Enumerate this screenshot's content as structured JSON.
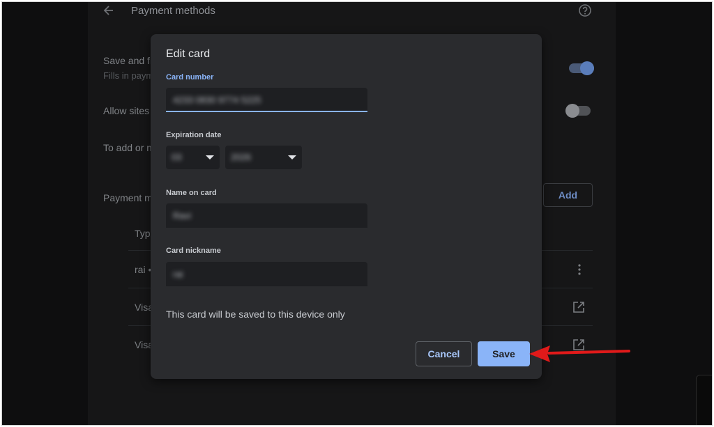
{
  "settings_page": {
    "title": "Payment methods",
    "autofill_label": "Save and fi",
    "autofill_sub": "Fills in paym",
    "allow_sites_label": "Allow sites",
    "add_note": "To add or m",
    "section_label": "Payment m",
    "add_button": "Add",
    "list_header": "Type",
    "rows": [
      "rai •",
      "Visa",
      "Visa"
    ]
  },
  "dialog": {
    "title": "Edit card",
    "card_number_label": "Card number",
    "card_number_value": "4233 0830 9774 5225",
    "expiration_label": "Expiration date",
    "month_value": "03",
    "year_value": "2026",
    "name_label": "Name on card",
    "name_value": "Ravi",
    "nickname_label": "Card nickname",
    "nickname_value": "rai",
    "note": "This card will be saved to this device only",
    "cancel_label": "Cancel",
    "save_label": "Save"
  },
  "colors": {
    "accent": "#8ab4f8",
    "arrow": "#e01a1a",
    "dialog_bg": "#2a2b2e"
  },
  "icons": [
    "back-arrow-icon",
    "help-icon",
    "more-vert-icon",
    "open-external-icon",
    "dropdown-caret-icon"
  ]
}
